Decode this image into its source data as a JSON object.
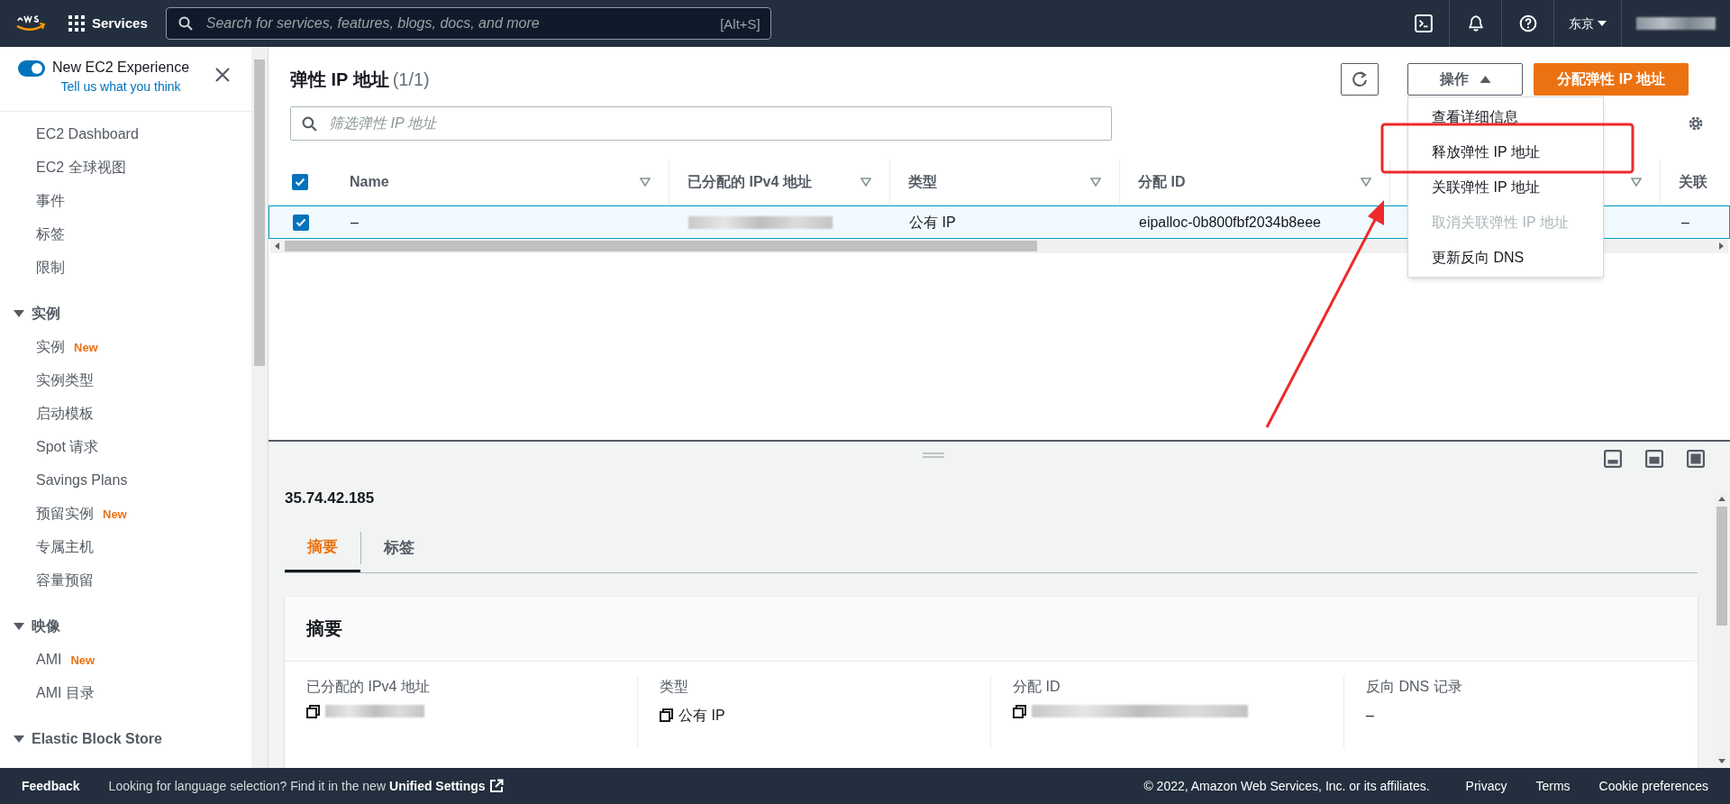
{
  "top_nav": {
    "services": "Services",
    "search_placeholder": "Search for services, features, blogs, docs, and more",
    "search_shortcut": "[Alt+S]",
    "region": "东京"
  },
  "sidebar": {
    "experience": {
      "label": "New EC2 Experience",
      "on": true,
      "link": "Tell us what you think"
    },
    "items": [
      {
        "kind": "link",
        "label": "EC2 Dashboard"
      },
      {
        "kind": "link",
        "label": "EC2 全球视图"
      },
      {
        "kind": "link",
        "label": "事件"
      },
      {
        "kind": "link",
        "label": "标签"
      },
      {
        "kind": "link",
        "label": "限制"
      },
      {
        "kind": "section",
        "label": "实例",
        "expanded": true,
        "children": [
          {
            "label": "实例",
            "badge": "New"
          },
          {
            "label": "实例类型"
          },
          {
            "label": "启动模板"
          },
          {
            "label": "Spot 请求"
          },
          {
            "label": "Savings Plans"
          },
          {
            "label": "预留实例",
            "badge": "New"
          },
          {
            "label": "专属主机"
          },
          {
            "label": "容量预留"
          }
        ]
      },
      {
        "kind": "section",
        "label": "映像",
        "expanded": true,
        "children": [
          {
            "label": "AMI",
            "badge": "New"
          },
          {
            "label": "AMI 目录"
          }
        ]
      },
      {
        "kind": "section",
        "label": "Elastic Block Store",
        "expanded": true
      }
    ]
  },
  "panel": {
    "title": "弹性 IP 地址",
    "count": "(1/1)",
    "actions_button": "操作",
    "actions_expanded": true,
    "primary_button": "分配弹性 IP 地址",
    "filter_placeholder": "筛选弹性 IP 地址",
    "all_selected": true,
    "columns": [
      {
        "label": "Name"
      },
      {
        "label": "已分配的 IPv4 地址"
      },
      {
        "label": "类型"
      },
      {
        "label": "分配 ID"
      },
      {},
      {
        "label": "关联"
      }
    ],
    "rows": [
      {
        "selected": true,
        "name": "–",
        "type": "公有 IP",
        "allocation_id": "eipalloc-0b800fbf2034b8eee",
        "column_6": "–"
      }
    ],
    "actions_menu": [
      {
        "label": "查看详细信息",
        "disabled": false
      },
      {
        "label": "释放弹性 IP 地址",
        "disabled": false
      },
      {
        "label": "关联弹性 IP 地址",
        "disabled": false
      },
      {
        "label": "取消关联弹性 IP 地址",
        "disabled": true
      },
      {
        "label": "更新反向 DNS",
        "disabled": false
      }
    ]
  },
  "details": {
    "title": "35.74.42.185",
    "tabs": [
      {
        "label": "摘要",
        "selected": true
      },
      {
        "label": "标签",
        "selected": false
      }
    ],
    "card_title": "摘要",
    "fields": [
      {
        "label": "已分配的 IPv4 地址",
        "kind": "blurred",
        "copyable": true
      },
      {
        "label": "类型",
        "kind": "text",
        "value": "公有 IP",
        "copyable": true
      },
      {
        "label": "分配 ID",
        "kind": "blurred",
        "copyable": true
      },
      {
        "label": "反向 DNS 记录",
        "kind": "text",
        "value": "–",
        "copyable": false
      }
    ]
  },
  "footer": {
    "feedback": "Feedback",
    "language_note": "Looking for language selection? Find it in the new",
    "unified_settings": "Unified Settings",
    "copyright": "© 2022, Amazon Web Services, Inc. or its affiliates.",
    "links": [
      "Privacy",
      "Terms",
      "Cookie preferences"
    ]
  }
}
